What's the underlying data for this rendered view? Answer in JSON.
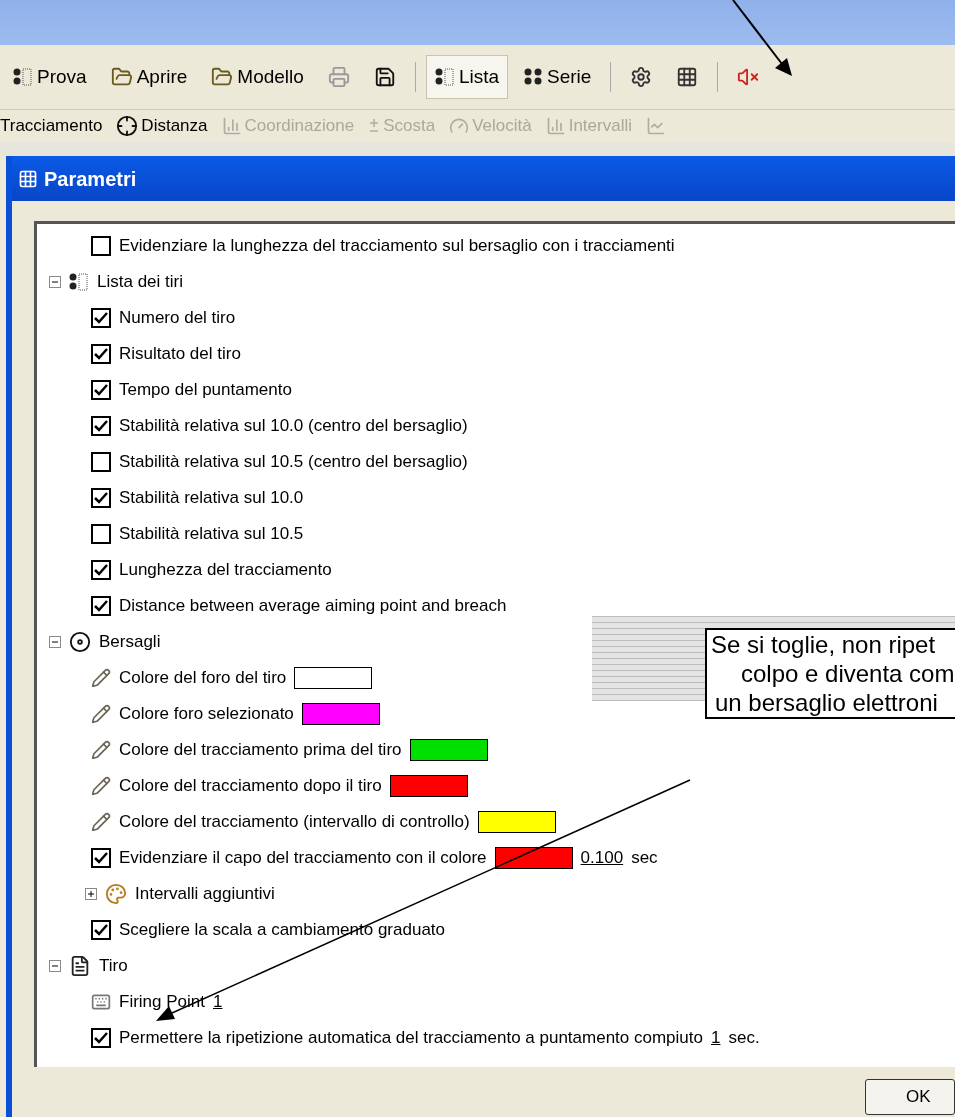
{
  "toolbar": [
    {
      "kind": "dots",
      "label": "Prova",
      "pressed": false
    },
    {
      "kind": "folder",
      "label": "Aprire",
      "pressed": false
    },
    {
      "kind": "folder",
      "label": "Modello",
      "pressed": false
    },
    {
      "kind": "printer",
      "pressed": false
    },
    {
      "kind": "save",
      "pressed": false
    },
    {
      "kind": "sep"
    },
    {
      "kind": "list",
      "label": "Lista",
      "pressed": true
    },
    {
      "kind": "series",
      "label": "Serie",
      "pressed": false
    },
    {
      "kind": "sep"
    },
    {
      "kind": "settings",
      "pressed": false
    },
    {
      "kind": "params",
      "pressed": false
    },
    {
      "kind": "sep"
    },
    {
      "kind": "mute",
      "pressed": false
    }
  ],
  "views": [
    {
      "kind": "none",
      "label": "Tracciamento",
      "disabled": false
    },
    {
      "kind": "target",
      "label": "Distanza",
      "disabled": false
    },
    {
      "kind": "chart",
      "label": "Coordinazione",
      "disabled": true
    },
    {
      "kind": "plusminus",
      "label": "Scosta",
      "disabled": true
    },
    {
      "kind": "gauge",
      "label": "Velocità",
      "disabled": true
    },
    {
      "kind": "bars",
      "label": "Intervalli",
      "disabled": true
    },
    {
      "kind": "line",
      "disabled": true
    }
  ],
  "dialog": {
    "title": "Parametri",
    "tree": [
      {
        "kind": "checkbox",
        "label": "Evidenziare la lunghezza del tracciamento sul bersaglio con i tracciamenti",
        "checked": false
      },
      {
        "kind": "group",
        "label": "Lista dei tiri",
        "expanded": true,
        "children": [
          {
            "kind": "checkbox",
            "label": "Numero del tiro",
            "checked": true
          },
          {
            "kind": "checkbox",
            "label": "Risultato del tiro",
            "checked": true
          },
          {
            "kind": "checkbox",
            "label": "Tempo del puntamento",
            "checked": true
          },
          {
            "kind": "checkbox",
            "label": "Stabilità relativa sul 10.0 (centro del bersaglio)",
            "checked": true
          },
          {
            "kind": "checkbox",
            "label": "Stabilità relativa sul  10.5 (centro del bersaglio)",
            "checked": false
          },
          {
            "kind": "checkbox",
            "label": "Stabilità relativa sul 10.0",
            "checked": true
          },
          {
            "kind": "checkbox",
            "label": "Stabilità relativa sul 10.5",
            "checked": false
          },
          {
            "kind": "checkbox",
            "label": "Lunghezza del tracciamento",
            "checked": true
          },
          {
            "kind": "checkbox",
            "label": "Distance between average aiming point and breach",
            "checked": true
          }
        ]
      },
      {
        "kind": "group",
        "label": "Bersagli",
        "expanded": true,
        "children": [
          {
            "kind": "color",
            "label": "Colore del foro del tiro",
            "color": "#ffffff"
          },
          {
            "kind": "color",
            "label": "Colore foro selezionato",
            "color": "#ff00ff"
          },
          {
            "kind": "color",
            "label": "Colore del tracciamento prima del tiro",
            "color": "#00e000"
          },
          {
            "kind": "color",
            "label": "Colore del tracciamento dopo il tiro",
            "color": "#ff0000"
          },
          {
            "kind": "color",
            "label": "Colore del tracciamento (intervallo di controllo)",
            "color": "#ffff00"
          },
          {
            "kind": "checkbox",
            "label": "Evidenziare il capo del tracciamento con il colore",
            "checked": true,
            "color": "#ff0000",
            "value": "0.100",
            "suffix": "sec"
          },
          {
            "kind": "group",
            "label": "Intervalli aggiuntivi",
            "expanded": false
          },
          {
            "kind": "checkbox",
            "label": "Scegliere la scala a cambiamento graduato",
            "checked": true
          }
        ]
      },
      {
        "kind": "group",
        "label": "Tiro",
        "expanded": true,
        "children": [
          {
            "kind": "field",
            "label": "Firing Point",
            "value": "1"
          },
          {
            "kind": "checkbox",
            "label": "Permettere la ripetizione automatica del tracciamento a puntamento compiuto",
            "checked": true,
            "value": "1",
            "suffix": "sec."
          }
        ]
      }
    ],
    "buttons": [
      "OK"
    ]
  },
  "callout": {
    "lines": [
      "Se si toglie, non ripet",
      "colpo e diventa com",
      "un bersaglio elettroni"
    ]
  }
}
